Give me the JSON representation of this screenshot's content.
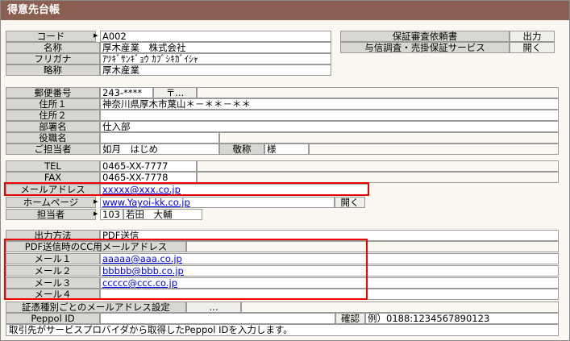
{
  "window_title": "得意先台帳",
  "customer": {
    "code_label": "コード",
    "code_value": "A002",
    "name_label": "名称",
    "name_value": "厚木産業　株式会社",
    "furigana_label": "フリガナ",
    "furigana_value": "ｱﾂｷﾞｻﾝｷﾞｮｳ ｶﾌﾞｼｷｶﾞｲｼｬ",
    "short_label": "略称",
    "short_value": "厚木産業"
  },
  "side_panel": {
    "row1_label": "保証審査依頼書",
    "row1_button": "出力",
    "row2_label": "与信調査・売掛保証サービス",
    "row2_button": "開く"
  },
  "address": {
    "postal_label": "郵便番号",
    "postal_value": "243-****",
    "postal_button": "〒...",
    "addr1_label": "住所１",
    "addr1_value": "神奈川県厚木市葉山＊－＊＊－＊＊",
    "addr2_label": "住所２",
    "addr2_value": "",
    "dept_label": "部署名",
    "dept_value": "仕入部",
    "title_label": "役職名",
    "title_value": "",
    "contact_label": "ご担当者",
    "contact_value": "如月　はじめ",
    "honorific_label": "敬称",
    "honorific_value": "様",
    "tel_label": "TEL",
    "tel_value": "0465-XX-7777",
    "fax_label": "FAX",
    "fax_value": "0465-XX-7778",
    "mail_label": "メールアドレス",
    "mail_value": "xxxxx@xxx.co.jp",
    "hp_label": "ホームページ",
    "hp_value": "www.Yayoi-kk.co.jp",
    "hp_button": "開く",
    "staff_label": "担当者",
    "staff_code": "103",
    "staff_name": "若田　大輔"
  },
  "output": {
    "method_label": "出力方法",
    "method_value": "PDF送信",
    "cc_header": "PDF送信時のCC用メールアドレス",
    "mail1_label": "メール１",
    "mail1_value": "aaaaa@aaa.co.jp",
    "mail2_label": "メール２",
    "mail2_value": "bbbbb@bbb.co.jp",
    "mail3_label": "メール３",
    "mail3_value": "ccccc@ccc.co.jp",
    "mail4_label": "メール４",
    "mail4_value": "",
    "voucher_label": "証憑種別ごとのメールアドレス設定",
    "voucher_button": "...",
    "peppol_label": "Peppol ID",
    "peppol_value": "",
    "confirm_button": "確認",
    "peppol_example": "例）0188:1234567890123",
    "peppol_note": "取引先がサービスプロバイダから取得したPeppol IDを入力します。"
  },
  "colors": {
    "title_bar": "#8a5f52",
    "highlight": "#ee0000",
    "link": "#0000ee",
    "label_bg": "#d9d7d2"
  }
}
